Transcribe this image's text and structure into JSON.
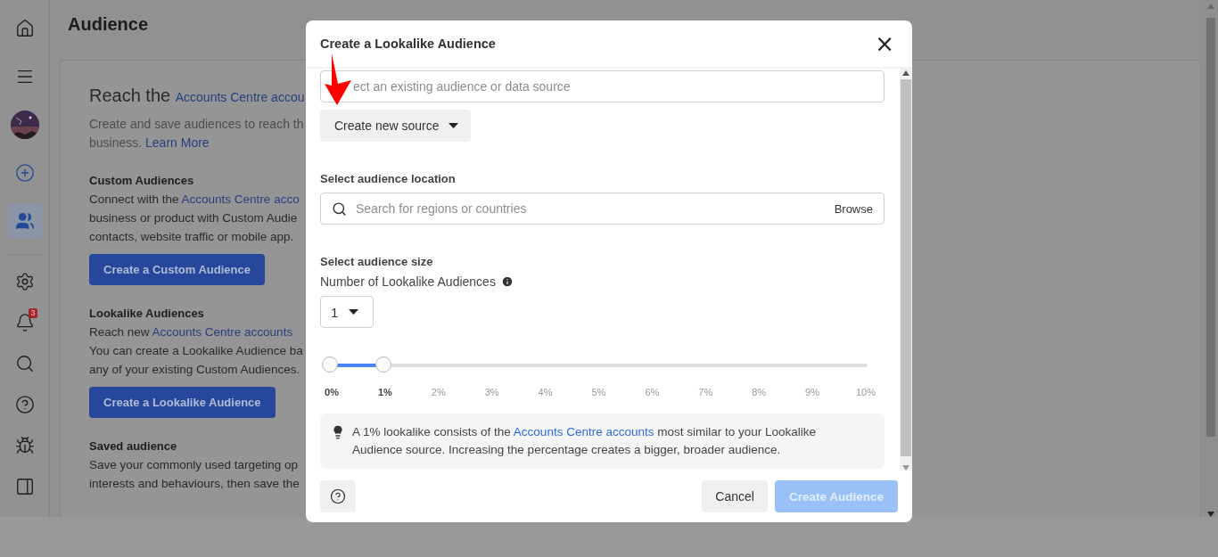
{
  "sidebar": {
    "items": [
      {
        "kind": "home",
        "selected": false
      },
      {
        "kind": "menu",
        "selected": false
      },
      {
        "kind": "avatar",
        "selected": false
      },
      {
        "kind": "add",
        "selected": false
      },
      {
        "kind": "people",
        "selected": true
      }
    ],
    "bottom_items": [
      {
        "kind": "settings"
      },
      {
        "kind": "bell",
        "badge": "3"
      },
      {
        "kind": "search"
      },
      {
        "kind": "help"
      },
      {
        "kind": "bug"
      },
      {
        "kind": "panel"
      }
    ]
  },
  "page": {
    "title": "Audience",
    "hero": {
      "heading": "Reach the",
      "heading_link": "Accounts Centre accou",
      "lines": [
        "Create and save audiences to reach th"
      ],
      "last_line": "business.",
      "learn_more": "Learn More"
    },
    "sections": [
      {
        "title": "Custom Audiences",
        "lines": [
          {
            "text": "Connect with the ",
            "link": "Accounts Centre acco"
          },
          {
            "text": "business or product with Custom Audie"
          },
          {
            "text": "contacts, website traffic or mobile app."
          }
        ],
        "button": "Create a Custom Audience"
      },
      {
        "title": "Lookalike Audiences",
        "lines": [
          {
            "text": "Reach new ",
            "link": "Accounts Centre accounts"
          },
          {
            "text": "You can create a Lookalike Audience ba"
          },
          {
            "text": "any of your existing Custom Audiences."
          }
        ],
        "button": "Create a Lookalike Audience"
      },
      {
        "title": "Saved audience",
        "lines": [
          {
            "text": "Save your commonly used targeting op"
          },
          {
            "text": "interests and behaviours, then save the"
          }
        ]
      }
    ]
  },
  "dialog": {
    "title": "Create a Lookalike Audience",
    "close": "×",
    "source": {
      "placeholder": "ect an existing audience or data source",
      "button": "Create new source"
    },
    "location": {
      "label": "Select audience location",
      "placeholder": "Search for regions or countries",
      "browse": "Browse"
    },
    "size": {
      "label": "Select audience size",
      "count_label": "Number of Lookalike Audiences",
      "count": "1",
      "slider": {
        "level": 0.1,
        "ticks": [
          {
            "label": "0%",
            "selected": true
          },
          {
            "label": "1%",
            "selected": true
          },
          {
            "label": "2%",
            "selected": false
          },
          {
            "label": "3%",
            "selected": false
          },
          {
            "label": "4%",
            "selected": false
          },
          {
            "label": "5%",
            "selected": false
          },
          {
            "label": "6%",
            "selected": false
          },
          {
            "label": "7%",
            "selected": false
          },
          {
            "label": "8%",
            "selected": false
          },
          {
            "label": "9%",
            "selected": false
          },
          {
            "label": "10%",
            "selected": false
          }
        ]
      }
    },
    "tip": {
      "before": "A 1% lookalike consists of the ",
      "link": "Accounts Centre accounts",
      "after": " most similar to your Lookalike Audience source. Increasing the percentage creates a bigger, broader audience."
    },
    "footer": {
      "cancel": "Cancel",
      "create": "Create Audience",
      "create_disabled": true
    }
  }
}
